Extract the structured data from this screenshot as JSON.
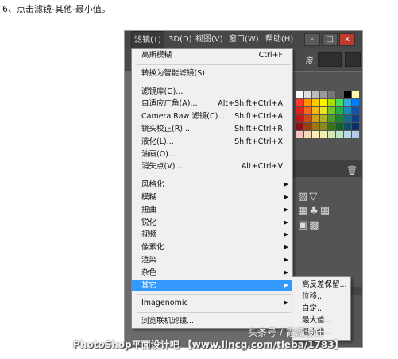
{
  "step_text": "6、点击滤镜-其他-最小值。",
  "menubar": {
    "items": [
      "滤镜(T)",
      "3D(D)",
      "视图(V)",
      "窗口(W)",
      "帮助(H)"
    ]
  },
  "window_buttons": [
    "-",
    "□",
    "×"
  ],
  "options_bar": {
    "label": "度:"
  },
  "filter_menu": {
    "items": [
      {
        "label": "高斯模糊",
        "shortcut": "Ctrl+F"
      },
      {
        "sep": true
      },
      {
        "label": "转换为智能滤镜(S)",
        "shortcut": ""
      },
      {
        "sep": true
      },
      {
        "label": "滤镜库(G)...",
        "shortcut": ""
      },
      {
        "label": "自适应广角(A)...",
        "shortcut": "Alt+Shift+Ctrl+A"
      },
      {
        "label": "Camera Raw 滤镜(C)...",
        "shortcut": "Shift+Ctrl+A"
      },
      {
        "label": "镜头校正(R)...",
        "shortcut": "Shift+Ctrl+R"
      },
      {
        "label": "液化(L)...",
        "shortcut": "Shift+Ctrl+X"
      },
      {
        "label": "油画(O)...",
        "shortcut": ""
      },
      {
        "label": "消失点(V)...",
        "shortcut": "Alt+Ctrl+V"
      },
      {
        "sep": true
      },
      {
        "label": "风格化",
        "submenu": true
      },
      {
        "label": "模糊",
        "submenu": true
      },
      {
        "label": "扭曲",
        "submenu": true
      },
      {
        "label": "锐化",
        "submenu": true
      },
      {
        "label": "视频",
        "submenu": true
      },
      {
        "label": "像素化",
        "submenu": true
      },
      {
        "label": "渲染",
        "submenu": true
      },
      {
        "label": "杂色",
        "submenu": true
      },
      {
        "label": "其它",
        "submenu": true,
        "highlighted": true
      },
      {
        "sep": true
      },
      {
        "label": "Imagenomic",
        "submenu": true
      },
      {
        "sep": true
      },
      {
        "label": "浏览联机滤镜...",
        "shortcut": ""
      }
    ]
  },
  "other_submenu": {
    "items": [
      "高反差保留...",
      "位移...",
      "自定...",
      "最大值...",
      "最小值..."
    ]
  },
  "swatch_colors": [
    "#ffffff",
    "#dddddd",
    "#bbbbbb",
    "#999999",
    "#777777",
    "#555555",
    "#000000",
    "#fff8b0",
    "#ff3b30",
    "#ff9500",
    "#ffcc00",
    "#fff200",
    "#a4de02",
    "#4cd964",
    "#34aadc",
    "#007aff",
    "#e0201b",
    "#ef6a1f",
    "#f6b819",
    "#e5e52a",
    "#6ec52d",
    "#2aa84a",
    "#1c8ab5",
    "#1553a8",
    "#c0171b",
    "#c84f1a",
    "#cfa11a",
    "#b0b22a",
    "#4e9a2a",
    "#1f7e3a",
    "#186a8a",
    "#123f82",
    "#8a1214",
    "#944213",
    "#9b7814",
    "#8a8c1f",
    "#3b7321",
    "#175e2b",
    "#124f66",
    "#0e2f61",
    "#f5c4c0",
    "#f7d9b8",
    "#f9ecb4",
    "#f0f0b0",
    "#d2ecb8",
    "#bfe5c6",
    "#b6d9e8",
    "#b8c8e8"
  ],
  "watermark": {
    "text": "PhotoShop平面设计吧 【www.lincg.com/tieba/1783】",
    "logo": "头条号 / 霞焗设计"
  },
  "colors": {
    "menu_highlight": "#3399ff",
    "menubar_bg": "#474747",
    "menu_bg": "#f0f0f0"
  }
}
